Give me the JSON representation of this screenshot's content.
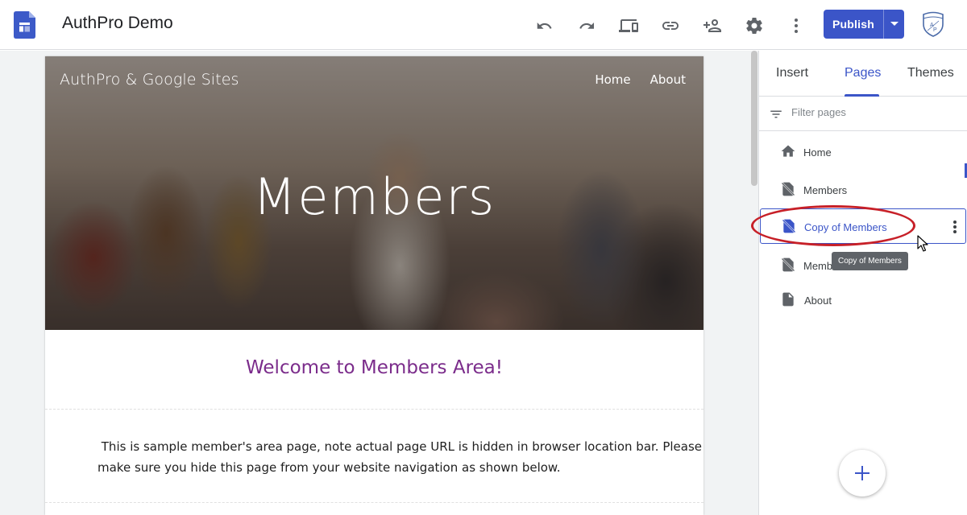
{
  "app": {
    "title": "AuthPro Demo",
    "publish_label": "Publish",
    "accent_color": "#3b55c8"
  },
  "toolbar": {
    "icons": [
      "undo-icon",
      "redo-icon",
      "preview-devices-icon",
      "link-icon",
      "share-person-add-icon",
      "settings-gear-icon",
      "more-vert-icon",
      "publish-dropdown-arrow-icon"
    ]
  },
  "site": {
    "name": "AuthPro & Google Sites",
    "nav": [
      "Home",
      "About"
    ],
    "hero_title": "Members",
    "welcome_heading": "Welcome to Members Area!",
    "welcome_color": "#7b2c8b",
    "paragraph_line1": " This is sample member's area page, note actual page URL is hidden in browser location bar. Please",
    "paragraph_line2": "make sure you hide this page from your website navigation as shown below."
  },
  "panel": {
    "tabs": [
      {
        "label": "Insert",
        "active": false
      },
      {
        "label": "Pages",
        "active": true
      },
      {
        "label": "Themes",
        "active": false
      }
    ],
    "filter_placeholder": "Filter pages",
    "pages": [
      {
        "label": "Home",
        "icon": "home-icon",
        "hidden": false,
        "selected": false
      },
      {
        "label": "Members",
        "icon": "hidden-page-icon",
        "hidden": true,
        "selected": false
      },
      {
        "label": "Copy of Members",
        "icon": "hidden-page-icon",
        "hidden": true,
        "selected": true
      },
      {
        "label": "Memb",
        "icon": "hidden-page-icon",
        "hidden": true,
        "selected": false
      },
      {
        "label": "About",
        "icon": "page-icon",
        "hidden": false,
        "selected": false
      }
    ],
    "tooltip": "Copy of Members",
    "add_button_icon": "plus-icon"
  }
}
